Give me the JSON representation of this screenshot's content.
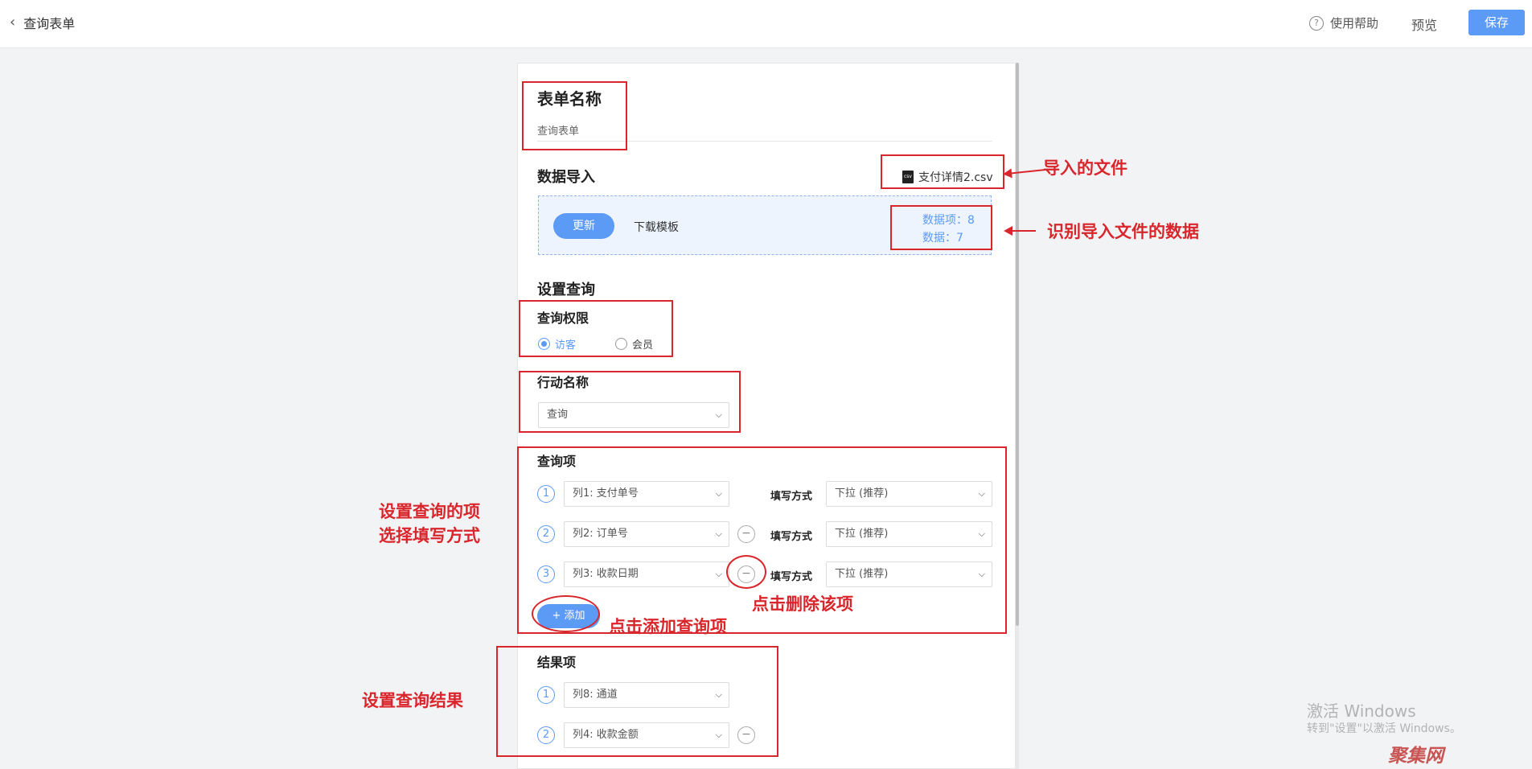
{
  "header": {
    "back_label": "查询表单",
    "help_label": "使用帮助",
    "preview_label": "预览",
    "save_label": "保存"
  },
  "form_name": {
    "title": "表单名称",
    "value": "查询表单"
  },
  "data_import": {
    "title": "数据导入",
    "file_name": "支付详情2.csv",
    "update_label": "更新",
    "download_label": "下载模板",
    "items_stat": "数据项：8",
    "rows_stat": "数据：7"
  },
  "query_settings": {
    "title": "设置查询",
    "permission": {
      "label": "查询权限",
      "options": [
        "访客",
        "会员"
      ],
      "selected": "访客"
    },
    "action": {
      "label": "行动名称",
      "value": "查询"
    },
    "query_items": {
      "label": "查询项",
      "fill_label": "填写方式",
      "rows": [
        {
          "index": "1",
          "column": "列1: 支付单号",
          "fill": "下拉 (推荐)"
        },
        {
          "index": "2",
          "column": "列2: 订单号",
          "fill": "下拉 (推荐)"
        },
        {
          "index": "3",
          "column": "列3: 收款日期",
          "fill": "下拉 (推荐)"
        }
      ],
      "add_label": "+ 添加"
    },
    "result_items": {
      "label": "结果项",
      "rows": [
        {
          "index": "1",
          "column": "列8: 通道"
        },
        {
          "index": "2",
          "column": "列4: 收款金额"
        }
      ]
    }
  },
  "annotations": {
    "imported_file": "导入的文件",
    "recognize_data": "识别导入文件的数据",
    "set_query_items_1": "设置查询的项",
    "set_query_items_2": "选择填写方式",
    "delete_item": "点击删除该项",
    "add_item": "点击添加查询项",
    "set_result": "设置查询结果"
  },
  "watermark": {
    "line1": "激活 Windows",
    "line2": "转到\"设置\"以激活 Windows。",
    "logo": "聚集网"
  },
  "colors": {
    "accent": "#5b9af5",
    "annotation_red": "#d9262c"
  }
}
